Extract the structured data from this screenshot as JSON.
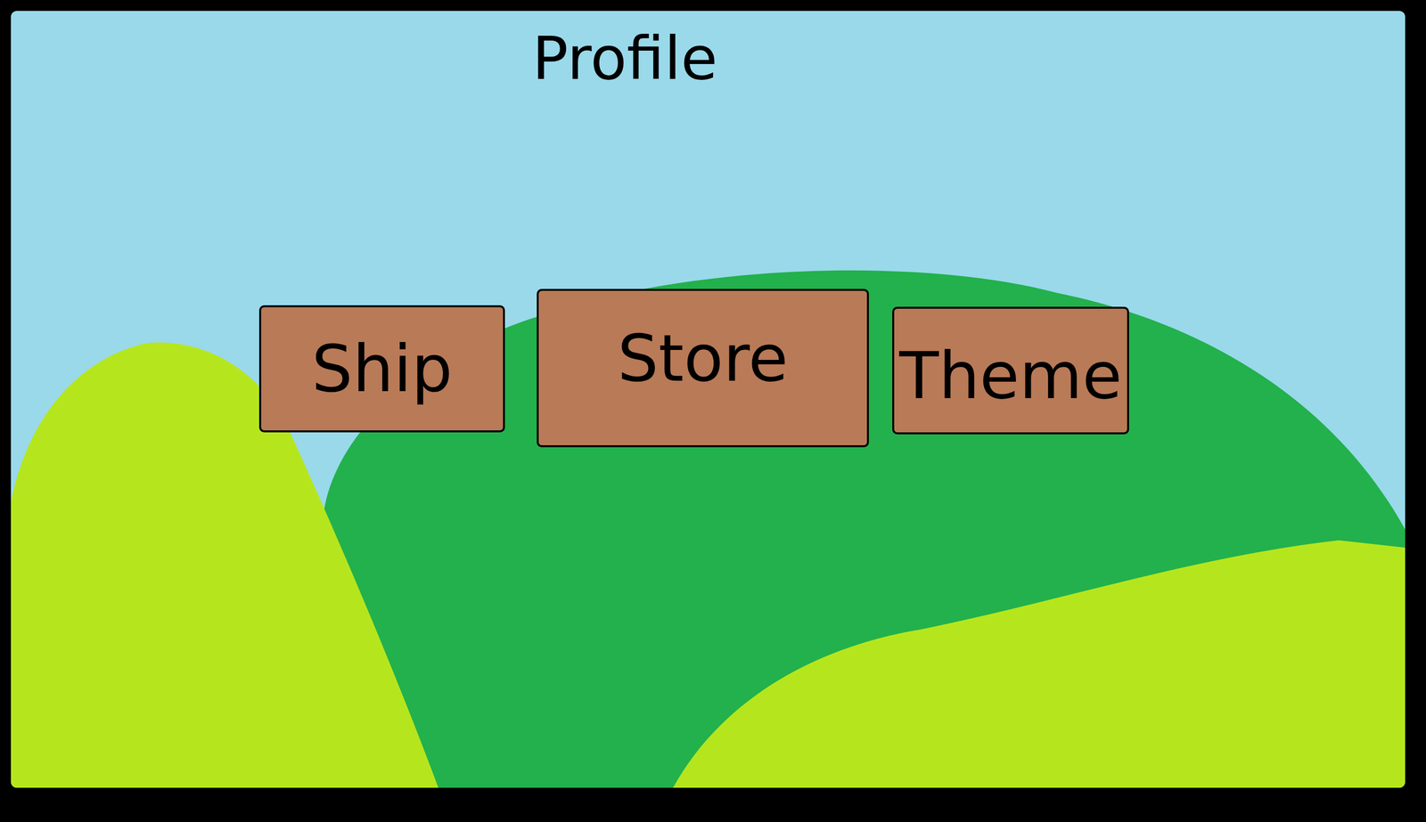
{
  "screen": {
    "title": "Profile"
  },
  "buttons": [
    {
      "label": "Ship"
    },
    {
      "label": "Store"
    },
    {
      "label": "Theme"
    }
  ]
}
